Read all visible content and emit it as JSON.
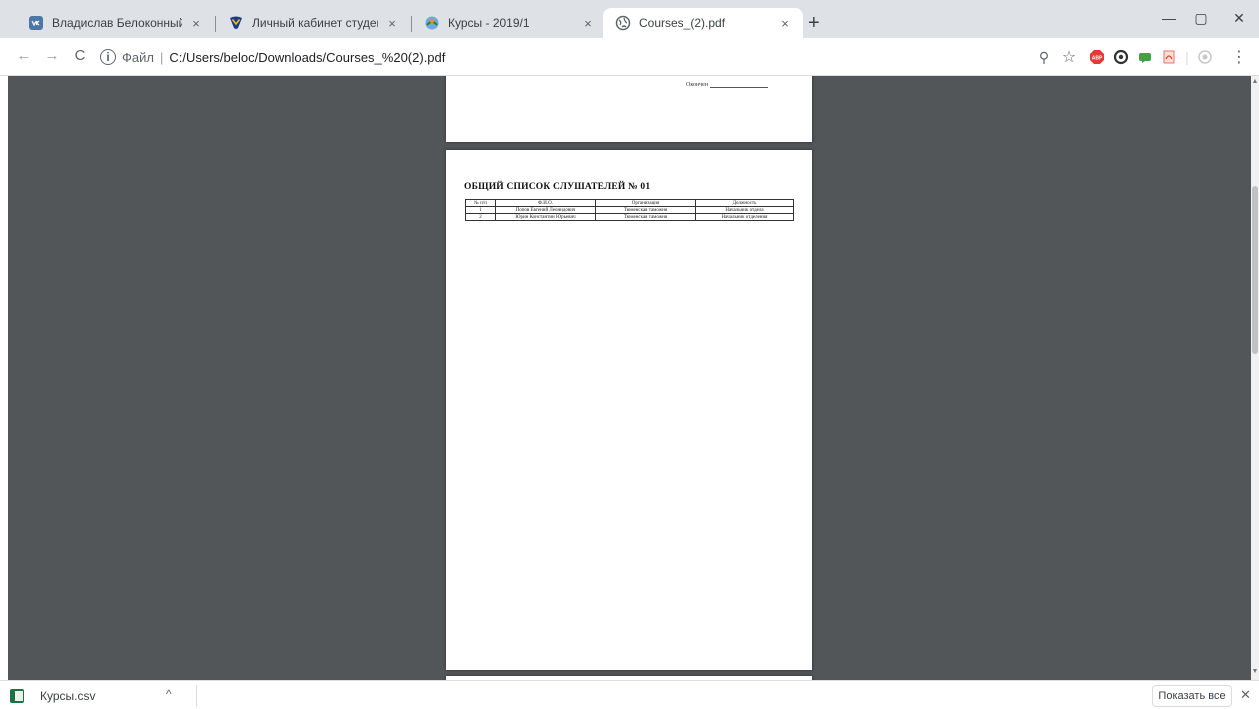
{
  "tabs": [
    {
      "title": "Владислав Белоконный",
      "icon": "vk-icon",
      "active": false
    },
    {
      "title": "Личный кабинет студента/аспи",
      "icon": "university-icon",
      "active": false
    },
    {
      "title": "Курсы - 2019/1",
      "icon": "moodle-icon",
      "active": false
    },
    {
      "title": "Courses_(2).pdf",
      "icon": "globe-icon",
      "active": true
    }
  ],
  "tab_close_glyph": "×",
  "new_tab_glyph": "+",
  "window": {
    "minimize": "—",
    "maximize": "▢",
    "close": "✕"
  },
  "toolbar": {
    "back": "←",
    "forward": "→",
    "reload": "C",
    "info_glyph": "i",
    "scheme_label": "Файл",
    "separator": "|",
    "url": "C:/Users/beloc/Downloads/Courses_%20(2).pdf",
    "zoom_glyph": "⚲",
    "star_glyph": "☆",
    "menu_glyph": "⋮"
  },
  "extensions": [
    {
      "name": "adblock-icon",
      "color": "#e53935",
      "label": "ABP"
    },
    {
      "name": "extension-ring-icon",
      "color": "#333333",
      "label": ""
    },
    {
      "name": "extension-chat-icon",
      "color": "#43a047",
      "label": ""
    },
    {
      "name": "extension-pdf-icon",
      "color": "#f4a582",
      "label": ""
    },
    {
      "name": "extension-grey-icon",
      "color": "#c8c8c8",
      "label": ""
    }
  ],
  "document": {
    "signature_label": "Окончен",
    "title": "ОБЩИЙ СПИСОК СЛУШАТЕЛЕЙ № 01",
    "table": {
      "headers": [
        "№ п/п",
        "Ф.И.О.",
        "Организация",
        "Должность"
      ],
      "rows": [
        [
          "1",
          "Попов Евгений Леонидович",
          "Тюменская таможня",
          "Начальник отдела"
        ],
        [
          "2",
          "Юрин Константин Юрьевич",
          "Тюменская таможня",
          "Начальник отделения"
        ]
      ]
    }
  },
  "downloads": {
    "file_name": "Курсы.csv",
    "chevron": "^",
    "show_all": "Показать все",
    "close": "✕"
  }
}
